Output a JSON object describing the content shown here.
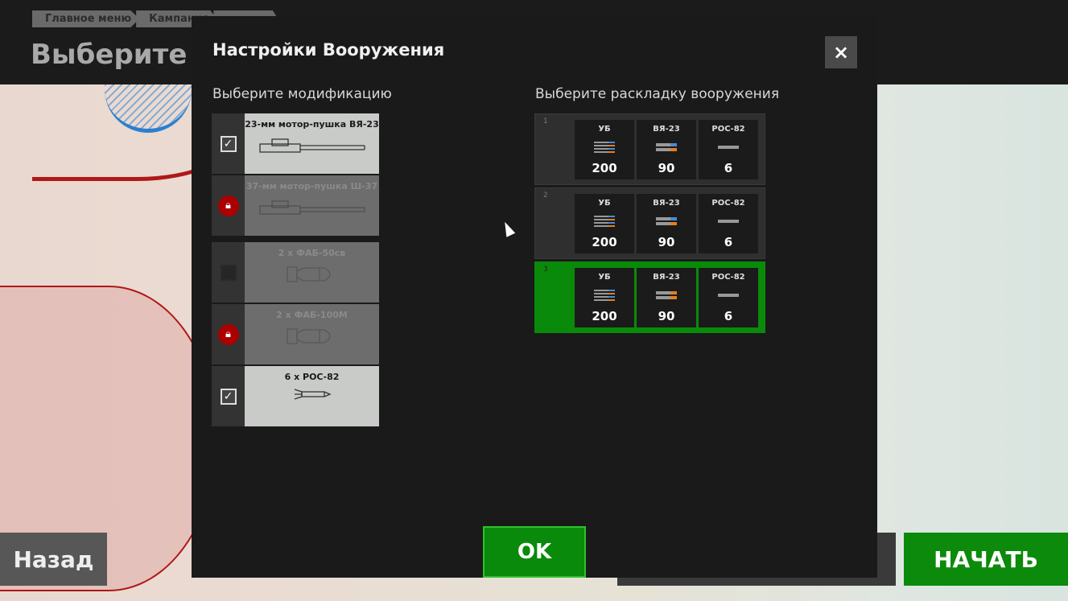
{
  "topbar": {
    "breadcrumbs": [
      "Главное меню",
      "Кампания",
      ""
    ],
    "title": "Выберите з"
  },
  "footer": {
    "back_label": "Назад",
    "start_label": "НАЧАТЬ"
  },
  "modal": {
    "title": "Настройки Вооружения",
    "close_label": "×",
    "mods_heading": "Выберите модификацию",
    "loadout_heading": "Выберите раскладку вооружения",
    "ok_label": "OK",
    "modifications": [
      {
        "name": "23-мм мотор-пушка ВЯ-23",
        "state": "checked",
        "icon": "cannon-icon"
      },
      {
        "name": "37-мм мотор-пушка Ш-37",
        "state": "locked",
        "icon": "cannon-icon"
      },
      {
        "name": "2 x ФАБ-50св",
        "state": "unchecked",
        "icon": "bomb-icon"
      },
      {
        "name": "2 x ФАБ-100М",
        "state": "locked",
        "icon": "bomb-icon"
      },
      {
        "name": "6 x РОС-82",
        "state": "checked",
        "icon": "rocket-icon"
      }
    ],
    "loadouts": [
      {
        "num": "1",
        "selected": false,
        "items": [
          {
            "name": "УБ",
            "value": "200"
          },
          {
            "name": "ВЯ-23",
            "value": "90"
          },
          {
            "name": "РОС-82",
            "value": "6"
          }
        ]
      },
      {
        "num": "2",
        "selected": false,
        "items": [
          {
            "name": "УБ",
            "value": "200"
          },
          {
            "name": "ВЯ-23",
            "value": "90"
          },
          {
            "name": "РОС-82",
            "value": "6"
          }
        ]
      },
      {
        "num": "3",
        "selected": true,
        "items": [
          {
            "name": "УБ",
            "value": "200"
          },
          {
            "name": "ВЯ-23",
            "value": "90"
          },
          {
            "name": "РОС-82",
            "value": "6"
          }
        ]
      }
    ]
  },
  "colors": {
    "accent": "#0a8a0a",
    "lock": "#aa0000"
  }
}
